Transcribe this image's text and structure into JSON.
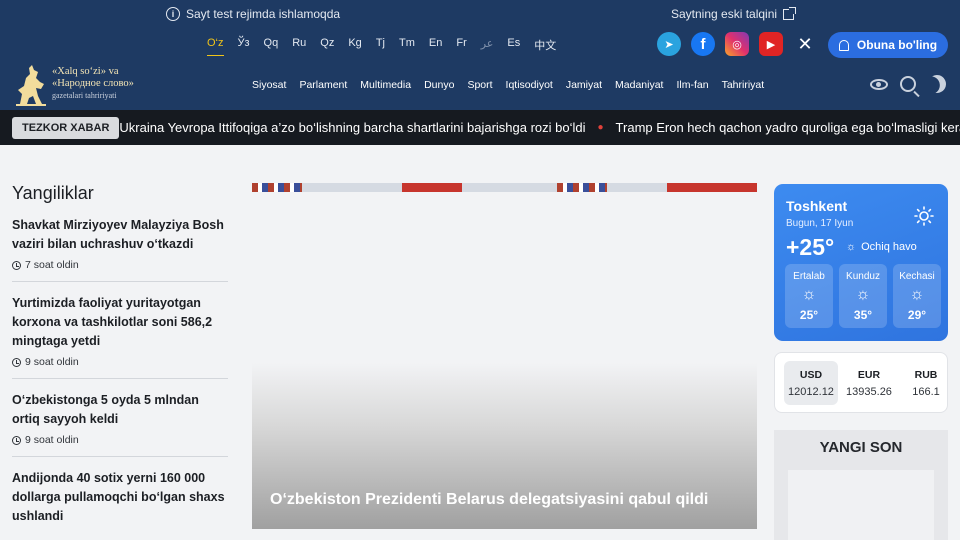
{
  "header": {
    "test_note": "Sayt test rejimda ishlamoqda",
    "old_version_link": "Saytning eski talqini",
    "languages": [
      {
        "label": "O‘z",
        "active": true
      },
      {
        "label": "Ўз"
      },
      {
        "label": "Qq"
      },
      {
        "label": "Ru"
      },
      {
        "label": "Qz"
      },
      {
        "label": "Kg"
      },
      {
        "label": "Tj"
      },
      {
        "label": "Tm"
      },
      {
        "label": "En"
      },
      {
        "label": "Fr"
      },
      {
        "label": "عر",
        "faded": true
      },
      {
        "label": "Es"
      },
      {
        "label": "中文"
      }
    ],
    "socials": [
      {
        "name": "telegram-icon",
        "glyph": "➤"
      },
      {
        "name": "facebook-icon",
        "glyph": "f"
      },
      {
        "name": "instagram-icon",
        "glyph": "◎"
      },
      {
        "name": "youtube-icon",
        "glyph": "▶"
      },
      {
        "name": "x-icon",
        "glyph": "✕"
      }
    ],
    "subscribe_label": "Obuna bo'ling",
    "logo": {
      "line1": "«Xalq so‘zi» va",
      "line2": "«Народное слово»",
      "line3": "gazetalari tahririyati"
    },
    "nav": [
      "Siyosat",
      "Parlament",
      "Multimedia",
      "Dunyo",
      "Sport",
      "Iqtisodiyot",
      "Jamiyat",
      "Madaniyat",
      "Ilm-fan",
      "Tahririyat"
    ]
  },
  "ticker": {
    "badge": "TEZKOR XABAR",
    "items": [
      "Ukraina Yevropa Ittifoqiga a’zo bo‘lishning barcha shartlarini bajarishga rozi bo‘ldi",
      "Tramp Eron hech qachon yadro quroliga ega bo‘lmasligi kerak"
    ]
  },
  "news": {
    "title": "Yangiliklar",
    "items": [
      {
        "title": "Shavkat Mirziyoyev Malayziya Bosh vaziri bilan uchrashuv o‘tkazdi",
        "time": "7 soat oldin"
      },
      {
        "title": "Yurtimizda faoliyat yuritayotgan korxona va tashkilotlar soni 586,2 mingtaga yetdi",
        "time": "9 soat oldin"
      },
      {
        "title": "O‘zbekistonga 5 oyda 5 mlndan ortiq sayyoh keldi",
        "time": "9 soat oldin"
      },
      {
        "title": "Andijonda 40 sotix yerni 160 000 dollarga pullamoqchi bo‘lgan shaxs ushlandi",
        "time": ""
      }
    ]
  },
  "hero": {
    "title": "O‘zbekiston Prezidenti Belarus delegatsiyasini qabul qildi"
  },
  "weather": {
    "city": "Toshkent",
    "date": "Bugun, 17 Iyun",
    "temp": "+25°",
    "desc": "Ochiq havo",
    "periods": [
      {
        "label": "Ertalab",
        "temp": "25°"
      },
      {
        "label": "Kunduz",
        "temp": "35°"
      },
      {
        "label": "Kechasi",
        "temp": "29°"
      }
    ]
  },
  "rates": [
    {
      "code": "USD",
      "value": "12012.12",
      "active": true
    },
    {
      "code": "EUR",
      "value": "13935.26"
    },
    {
      "code": "RUB",
      "value": "166.1"
    }
  ],
  "newspaper": {
    "title": "YANGI SON"
  }
}
